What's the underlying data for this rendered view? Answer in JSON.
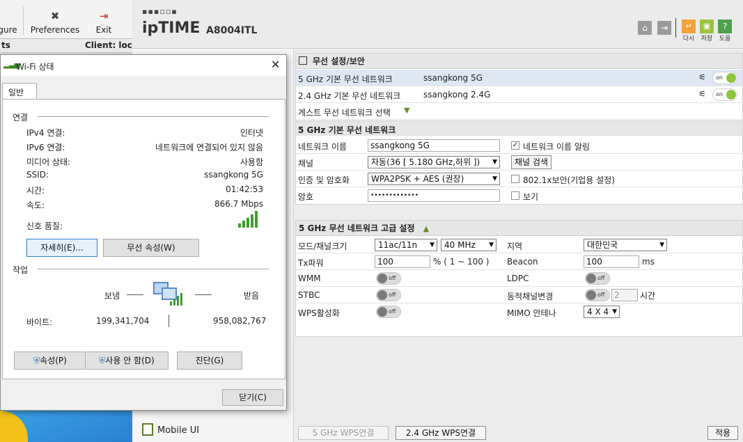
{
  "background_app": {
    "toolbar": {
      "configure": "gure",
      "preferences": "Preferences",
      "exit": "Exit"
    },
    "strip": {
      "left": "ts",
      "client": "Client: loc"
    }
  },
  "router": {
    "brand": "ipTIME",
    "model": "A8004ITL",
    "header_actions": {
      "reload": "다시",
      "save": "저장",
      "help": "도움"
    },
    "mobile_ui": "Mobile UI",
    "section_title": "무선 설정/보안",
    "networks": [
      {
        "band": "5 GHz 기본 무선 네트워크",
        "ssid": "ssangkong 5G",
        "state": "on"
      },
      {
        "band": "2.4 GHz 기본 무선 네트워크",
        "ssid": "ssangkong 2.4G",
        "state": "on"
      }
    ],
    "guest_select": "게스트 무선 네트워크 선택",
    "basic": {
      "title": "5 GHz 기본 무선 네트워크",
      "name_label": "네트워크 이름",
      "name_value": "ssangkong 5G",
      "broadcast_label": "네트워크 이름 알림",
      "channel_label": "채널",
      "channel_value": "자동(36 [ 5.180 GHz,하위 ])",
      "channel_search": "채널 검색",
      "auth_label": "인증 및 암호화",
      "auth_value": "WPA2PSK + AES (권장)",
      "8021x_label": "802.1x보안(기업용 설정)",
      "password_label": "암호",
      "password_value": "•••••••••••••",
      "show_label": "보기"
    },
    "advanced": {
      "title": "5 GHz 무선 네트워크 고급 설정",
      "mode_label": "모드/채널크기",
      "mode_value": "11ac/11n",
      "width_value": "40 MHz",
      "region_label": "지역",
      "region_value": "대한민국",
      "tx_label": "Tx파워",
      "tx_value": "100",
      "tx_range": "% ( 1 ~ 100 )",
      "beacon_label": "Beacon",
      "beacon_value": "100",
      "beacon_unit": "ms",
      "wmm_label": "WMM",
      "ldpc_label": "LDPC",
      "stbc_label": "STBC",
      "dyn_label": "동적채널변경",
      "dyn_value": "2",
      "dyn_unit": "시간",
      "wps_label": "WPS활성화",
      "mimo_label": "MIMO 안테나",
      "mimo_value": "4 X 4",
      "off_text": "off"
    },
    "footer": {
      "wps5": "5 GHz WPS연결",
      "wps24": "2.4 GHz WPS연결",
      "apply": "적용"
    }
  },
  "dialog": {
    "title": "Wi-Fi 상태",
    "tab": "일반",
    "connection_header": "연결",
    "rows": [
      {
        "k": "IPv4 연결:",
        "v": "인터넷"
      },
      {
        "k": "IPv6 연결:",
        "v": "네트워크에 연결되어 있지 않음"
      },
      {
        "k": "미디어 상태:",
        "v": "사용함"
      },
      {
        "k": "SSID:",
        "v": "ssangkong 5G"
      },
      {
        "k": "시간:",
        "v": "01:42:53"
      },
      {
        "k": "속도:",
        "v": "866.7 Mbps"
      }
    ],
    "signal_label": "신호 품질:",
    "details_button": "자세히(E)...",
    "wireless_props_button": "무선 속성(W)",
    "activity_header": "작업",
    "sent_label": "보냄",
    "received_label": "받음",
    "bytes_label": "바이트:",
    "bytes_sent": "199,341,704",
    "bytes_received": "958,082,767",
    "properties_button": "속성(P)",
    "disable_button": "사용 안 함(D)",
    "diagnose_button": "진단(G)",
    "close_button": "닫기(C)"
  }
}
